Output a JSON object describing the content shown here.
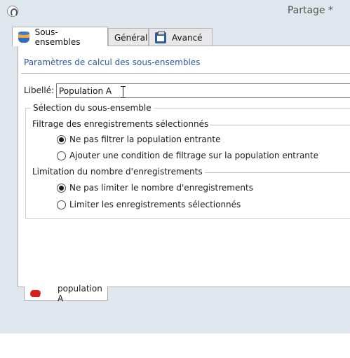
{
  "window": {
    "title": "Partage *"
  },
  "tabs": [
    {
      "label": "Sous-ensembles",
      "icon": "database-icon",
      "active": true
    },
    {
      "label": "Général",
      "active": false
    },
    {
      "label": "Avancé",
      "icon": "clipboard-icon",
      "active": false
    }
  ],
  "panel": {
    "section_title": "Paramètres de calcul des sous-ensembles",
    "libelle_label": "Libellé:",
    "libelle_value": "Population A",
    "group_legend": "Sélection du sous-ensemble",
    "filter": {
      "heading": "Filtrage des enregistrements sélectionnés",
      "options": [
        {
          "label": "Ne pas filtrer la population entrante",
          "checked": true
        },
        {
          "label": "Ajouter une condition de filtrage sur la population entrante",
          "checked": false
        }
      ]
    },
    "limit": {
      "heading": "Limitation du nombre d'enregistrements",
      "options": [
        {
          "label": "Ne pas limiter le nombre d'enregistrements",
          "checked": true
        },
        {
          "label": "Limiter les enregistrements sélectionnés",
          "checked": false
        }
      ]
    }
  },
  "bottom_tab": {
    "label": "population A",
    "icon": "population-icon"
  },
  "colors": {
    "section_title": "#2c5aa0",
    "window_bg": "#dfe6ee",
    "icon_red": "#d62020"
  }
}
